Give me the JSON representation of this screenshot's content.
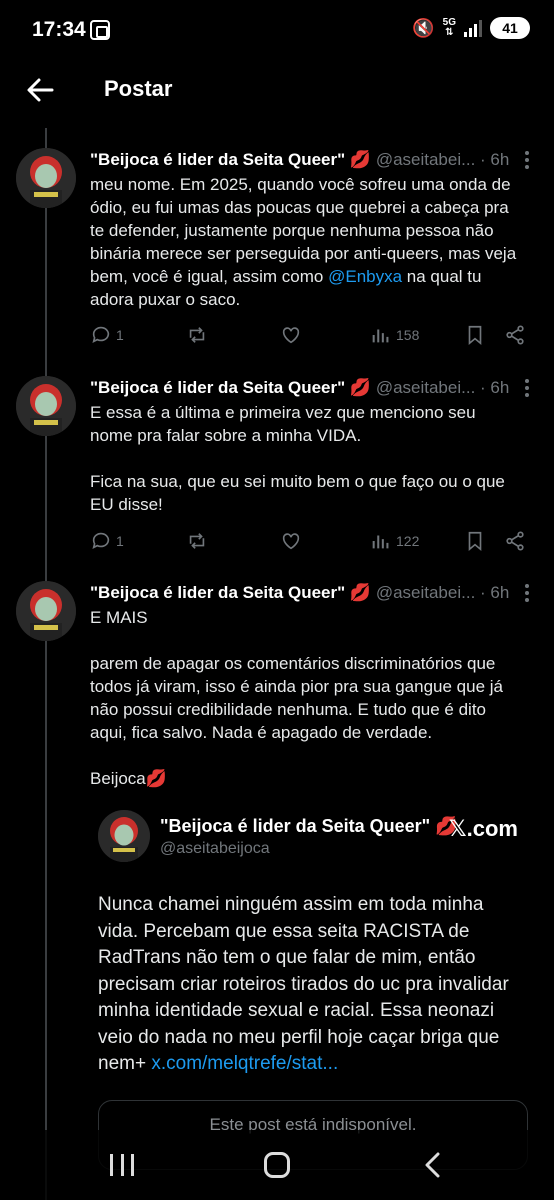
{
  "status": {
    "time": "17:34",
    "network": "5G",
    "battery": "41"
  },
  "header": {
    "title": "Postar"
  },
  "posts": [
    {
      "name": "\"Beijoca é lider da Seita Queer\"",
      "emoji": "💋",
      "handle": "@aseitabei...",
      "time": "· 6h",
      "text_a": "meu nome. Em 2025, quando você sofreu uma onda de ódio, eu fui umas das poucas que quebrei a cabeça pra te defender, justamente porque nenhuma pessoa não binária merece ser perseguida por anti-queers, mas veja bem, você é igual, assim como ",
      "mention": "@Enbyxa",
      "text_b": " na qual tu adora puxar o saco.",
      "replies": "1",
      "views": "158"
    },
    {
      "name": "\"Beijoca é lider da Seita Queer\"",
      "emoji": "💋",
      "handle": "@aseitabei...",
      "time": "· 6h",
      "text": "E essa é a última e primeira vez que menciono seu nome pra falar sobre a minha VIDA.\n\nFica na sua, que eu sei muito bem o que faço ou o que EU disse!",
      "replies": "1",
      "views": "122"
    },
    {
      "name": "\"Beijoca é lider da Seita Queer\"",
      "emoji": "💋",
      "handle": "@aseitabei...",
      "time": "· 6h",
      "text": "E MAIS\n\nparem de apagar os comentários discriminatórios que todos já viram, isso é ainda pior pra sua gangue que já não possui credibilidade nenhuma. E tudo que é dito aqui, fica salvo. Nada é apagado de verdade.\n\nBeijoca💋"
    }
  ],
  "quote": {
    "name": "\"Beijoca é lider da Seita Queer\"",
    "emoji": "💋",
    "handle": "@aseitabeijoca",
    "brand": "𝕏.com",
    "text": "Nunca chamei ninguém assim em toda minha vida. Percebam que essa seita RACISTA de RadTrans não tem o que falar de mim, então precisam criar roteiros tirados do uc pra invalidar minha identidade sexual e racial. Essa neonazi veio do nada no meu perfil hoje caçar briga que nem+ ",
    "link": "x.com/melqtrefe/stat...",
    "unavailable": "Este post está indisponível."
  },
  "icons": {
    "back": "arrow-left-icon",
    "more": "more-vertical-icon",
    "reply": "reply-icon",
    "repost": "repost-icon",
    "like": "heart-icon",
    "views": "bar-chart-icon",
    "bookmark": "bookmark-icon",
    "share": "share-icon"
  },
  "colors": {
    "background": "#000000",
    "text": "#e7e9ea",
    "muted": "#71767b",
    "accent": "#1d9bf0",
    "kiss": "#e0245e"
  }
}
